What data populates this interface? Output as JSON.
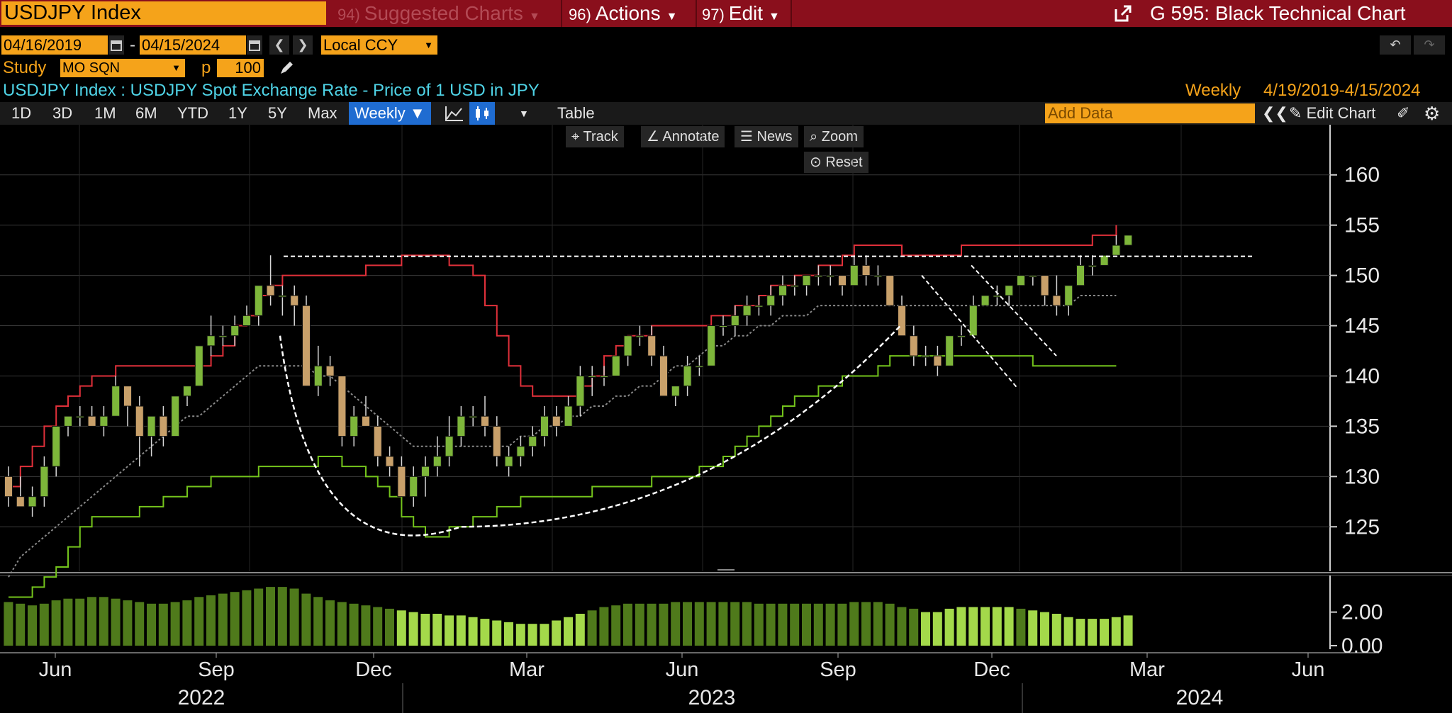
{
  "topbar": {
    "ticker": "USDJPY Index",
    "menus": [
      {
        "num": "94)",
        "label": "Suggested Charts"
      },
      {
        "num": "96)",
        "label": "Actions"
      },
      {
        "num": "97)",
        "label": "Edit"
      }
    ],
    "title": "G 595: Black Technical Chart"
  },
  "controls": {
    "start_date": "04/16/2019",
    "dash": "-",
    "end_date": "04/15/2024",
    "currency": "Local CCY",
    "study_label": "Study",
    "study_value": "MO SQN",
    "p_label": "p",
    "p_value": "100"
  },
  "info": {
    "security_desc": "USDJPY Index : USDJPY Spot Exchange Rate - Price of 1 USD in JPY",
    "frequency": "Weekly",
    "range": "4/19/2019-4/15/2024"
  },
  "toolbar": {
    "periods": [
      "1D",
      "3D",
      "1M",
      "6M",
      "YTD",
      "1Y",
      "5Y",
      "Max"
    ],
    "active_period": "Weekly ▼",
    "table": "Table",
    "add_data_placeholder": "Add Data",
    "edit_chart": "Edit Chart",
    "track": "Track",
    "annotate": "Annotate",
    "news": "News",
    "zoom": "Zoom",
    "reset": "Reset"
  },
  "colors": {
    "up_candle": "#7db63a",
    "down_candle": "#c8a06a",
    "upper_line": "#e0303a",
    "lower_line": "#74c41c",
    "mid_line": "#8a8a8a",
    "accent": "#f5a31a",
    "topbar": "#8a0f1c"
  },
  "chart_data": [
    {
      "type": "candlestick",
      "title": "USDJPY Spot Exchange Rate",
      "ylim": [
        121,
        164
      ],
      "yticks": [
        125,
        130,
        135,
        140,
        145,
        150,
        155,
        160
      ],
      "x_month_labels": [
        "Jun",
        "Sep",
        "Dec",
        "Mar",
        "Jun",
        "Sep",
        "Dec",
        "Mar",
        "Jun"
      ],
      "x_year_labels": [
        "2022",
        "2023",
        "2024"
      ],
      "candles": [
        [
          130,
          131,
          127,
          128
        ],
        [
          128,
          130,
          127,
          127
        ],
        [
          127,
          129,
          126,
          128
        ],
        [
          128,
          132,
          127,
          131
        ],
        [
          131,
          135,
          130,
          135
        ],
        [
          135,
          136,
          134,
          136
        ],
        [
          136,
          137,
          135,
          136
        ],
        [
          136,
          137,
          135,
          135
        ],
        [
          135,
          137,
          134,
          136
        ],
        [
          136,
          140,
          136,
          139
        ],
        [
          139,
          139,
          135,
          137
        ],
        [
          137,
          138,
          131,
          134
        ],
        [
          134,
          136,
          132,
          136
        ],
        [
          136,
          137,
          133,
          134
        ],
        [
          134,
          138,
          134,
          138
        ],
        [
          138,
          139,
          137,
          139
        ],
        [
          139,
          143,
          139,
          143
        ],
        [
          143,
          146,
          142,
          144
        ],
        [
          144,
          145,
          143,
          144
        ],
        [
          144,
          146,
          143,
          145
        ],
        [
          145,
          147,
          145,
          146
        ],
        [
          146,
          149,
          145,
          149
        ],
        [
          149,
          152,
          147,
          148
        ],
        [
          148,
          149,
          146,
          148
        ],
        [
          148,
          149,
          145,
          147
        ],
        [
          147,
          148,
          143,
          139
        ],
        [
          139,
          143,
          138,
          141
        ],
        [
          141,
          142,
          139,
          140
        ],
        [
          140,
          140,
          133,
          134
        ],
        [
          134,
          137,
          133,
          136
        ],
        [
          136,
          138,
          135,
          135
        ],
        [
          135,
          136,
          131,
          132
        ],
        [
          132,
          133,
          130,
          131
        ],
        [
          131,
          132,
          128,
          128
        ],
        [
          128,
          131,
          127,
          130
        ],
        [
          130,
          132,
          128,
          131
        ],
        [
          131,
          134,
          130,
          132
        ],
        [
          132,
          136,
          131,
          134
        ],
        [
          134,
          137,
          133,
          136
        ],
        [
          136,
          137,
          135,
          136
        ],
        [
          136,
          138,
          134,
          135
        ],
        [
          135,
          136,
          131,
          132
        ],
        [
          131,
          133,
          130,
          132
        ],
        [
          132,
          134,
          131,
          133
        ],
        [
          133,
          135,
          132,
          134
        ],
        [
          134,
          137,
          133,
          136
        ],
        [
          136,
          137,
          134,
          135
        ],
        [
          135,
          138,
          135,
          137
        ],
        [
          137,
          141,
          136,
          140
        ],
        [
          140,
          141,
          138,
          140
        ],
        [
          140,
          141,
          139,
          140
        ],
        [
          140,
          142,
          140,
          142
        ],
        [
          142,
          144,
          141,
          144
        ],
        [
          144,
          145,
          143,
          144
        ],
        [
          144,
          145,
          141,
          142
        ],
        [
          142,
          143,
          138,
          138
        ],
        [
          138,
          139,
          137,
          139
        ],
        [
          139,
          142,
          138,
          141
        ],
        [
          141,
          142,
          140,
          141
        ],
        [
          141,
          145,
          141,
          145
        ],
        [
          145,
          146,
          144,
          145
        ],
        [
          145,
          147,
          144,
          146
        ],
        [
          146,
          148,
          145,
          147
        ],
        [
          147,
          148,
          146,
          147
        ],
        [
          147,
          149,
          146,
          148
        ],
        [
          148,
          150,
          147,
          149
        ],
        [
          149,
          150,
          148,
          149
        ],
        [
          149,
          150,
          148,
          150
        ],
        [
          150,
          151,
          149,
          150
        ],
        [
          150,
          151,
          149,
          150
        ],
        [
          150,
          150,
          148,
          149
        ],
        [
          149,
          152,
          149,
          151
        ],
        [
          151,
          152,
          149,
          150
        ],
        [
          150,
          151,
          149,
          150
        ],
        [
          150,
          150,
          147,
          147
        ],
        [
          147,
          148,
          144,
          144
        ],
        [
          144,
          145,
          141,
          142
        ],
        [
          142,
          143,
          141,
          142
        ],
        [
          142,
          143,
          140,
          141
        ],
        [
          141,
          144,
          141,
          144
        ],
        [
          144,
          145,
          143,
          144
        ],
        [
          144,
          148,
          144,
          147
        ],
        [
          147,
          148,
          147,
          148
        ],
        [
          148,
          149,
          147,
          148
        ],
        [
          148,
          149,
          147,
          149
        ],
        [
          149,
          150,
          149,
          150
        ],
        [
          150,
          150,
          149,
          150
        ],
        [
          150,
          150,
          147,
          148
        ],
        [
          148,
          150,
          146,
          147
        ],
        [
          147,
          149,
          146,
          149
        ],
        [
          149,
          152,
          149,
          151
        ],
        [
          151,
          152,
          150,
          151
        ],
        [
          151,
          152,
          151,
          152
        ],
        [
          152,
          154,
          152,
          153
        ],
        [
          153,
          154,
          153,
          154
        ]
      ],
      "upper_band": [
        129,
        131,
        133,
        135,
        137,
        138,
        139,
        140,
        140,
        141,
        141,
        141,
        141,
        141,
        141,
        141,
        141,
        142,
        143,
        145,
        146,
        148,
        149,
        150,
        150,
        150,
        150,
        150,
        150,
        150,
        151,
        151,
        151,
        152,
        152,
        152,
        152,
        151,
        151,
        150,
        147,
        144,
        141,
        139,
        138,
        138,
        138,
        138,
        139,
        140,
        142,
        143,
        144,
        144,
        145,
        145,
        145,
        145,
        145,
        146,
        146,
        147,
        147,
        148,
        149,
        149,
        150,
        150,
        151,
        151,
        152,
        153,
        153,
        153,
        153,
        152,
        152,
        152,
        152,
        152,
        153,
        153,
        153,
        153,
        153,
        153,
        153,
        153,
        153,
        153,
        153,
        154,
        154,
        155
      ],
      "lower_band": [
        118,
        118,
        119,
        120,
        121,
        123,
        125,
        126,
        126,
        126,
        126,
        127,
        127,
        128,
        128,
        129,
        129,
        130,
        130,
        130,
        130,
        131,
        131,
        131,
        131,
        131,
        132,
        132,
        131,
        131,
        130,
        129,
        128,
        126,
        125,
        124,
        124,
        125,
        125,
        126,
        126,
        127,
        127,
        128,
        128,
        128,
        128,
        128,
        128,
        129,
        129,
        129,
        129,
        129,
        130,
        130,
        130,
        130,
        131,
        131,
        132,
        133,
        134,
        135,
        136,
        137,
        138,
        138,
        139,
        139,
        140,
        140,
        140,
        141,
        142,
        142,
        142,
        142,
        142,
        142,
        142,
        142,
        142,
        142,
        142,
        142,
        141,
        141,
        141,
        141,
        141,
        141,
        141,
        141
      ],
      "mid_line": [
        120,
        122,
        123,
        124,
        125,
        126,
        127,
        128,
        129,
        130,
        131,
        132,
        133,
        134,
        135,
        136,
        136,
        137,
        138,
        139,
        140,
        141,
        141,
        141,
        141,
        141,
        140,
        140,
        139,
        138,
        137,
        136,
        135,
        134,
        133,
        133,
        133,
        133,
        133,
        133,
        133,
        133,
        133,
        134,
        134,
        135,
        135,
        136,
        136,
        137,
        137,
        138,
        138,
        139,
        139,
        140,
        141,
        141,
        142,
        143,
        143,
        144,
        144,
        145,
        145,
        146,
        146,
        146,
        147,
        147,
        147,
        147,
        147,
        147,
        147,
        147,
        147,
        147,
        147,
        147,
        147,
        147,
        147,
        147,
        147,
        147,
        147,
        147,
        147,
        147,
        148,
        148,
        148,
        148
      ],
      "oscillator": {
        "type": "bar",
        "yticks": [
          0.0,
          2.0
        ],
        "values": [
          2.6,
          2.5,
          2.4,
          2.5,
          2.7,
          2.8,
          2.8,
          2.9,
          2.9,
          2.8,
          2.7,
          2.6,
          2.5,
          2.5,
          2.6,
          2.7,
          2.9,
          3.0,
          3.1,
          3.2,
          3.3,
          3.4,
          3.5,
          3.5,
          3.4,
          3.1,
          2.9,
          2.7,
          2.6,
          2.5,
          2.4,
          2.3,
          2.2,
          2.1,
          2.0,
          1.9,
          1.9,
          1.8,
          1.8,
          1.7,
          1.6,
          1.5,
          1.4,
          1.3,
          1.3,
          1.3,
          1.5,
          1.7,
          1.9,
          2.1,
          2.3,
          2.4,
          2.5,
          2.5,
          2.5,
          2.5,
          2.6,
          2.6,
          2.6,
          2.6,
          2.6,
          2.6,
          2.6,
          2.5,
          2.5,
          2.5,
          2.5,
          2.5,
          2.5,
          2.5,
          2.5,
          2.6,
          2.6,
          2.6,
          2.5,
          2.3,
          2.2,
          2.0,
          2.0,
          2.2,
          2.3,
          2.3,
          2.3,
          2.3,
          2.3,
          2.2,
          2.1,
          2.0,
          1.9,
          1.7,
          1.6,
          1.6,
          1.6,
          1.7,
          1.8
        ]
      }
    }
  ]
}
